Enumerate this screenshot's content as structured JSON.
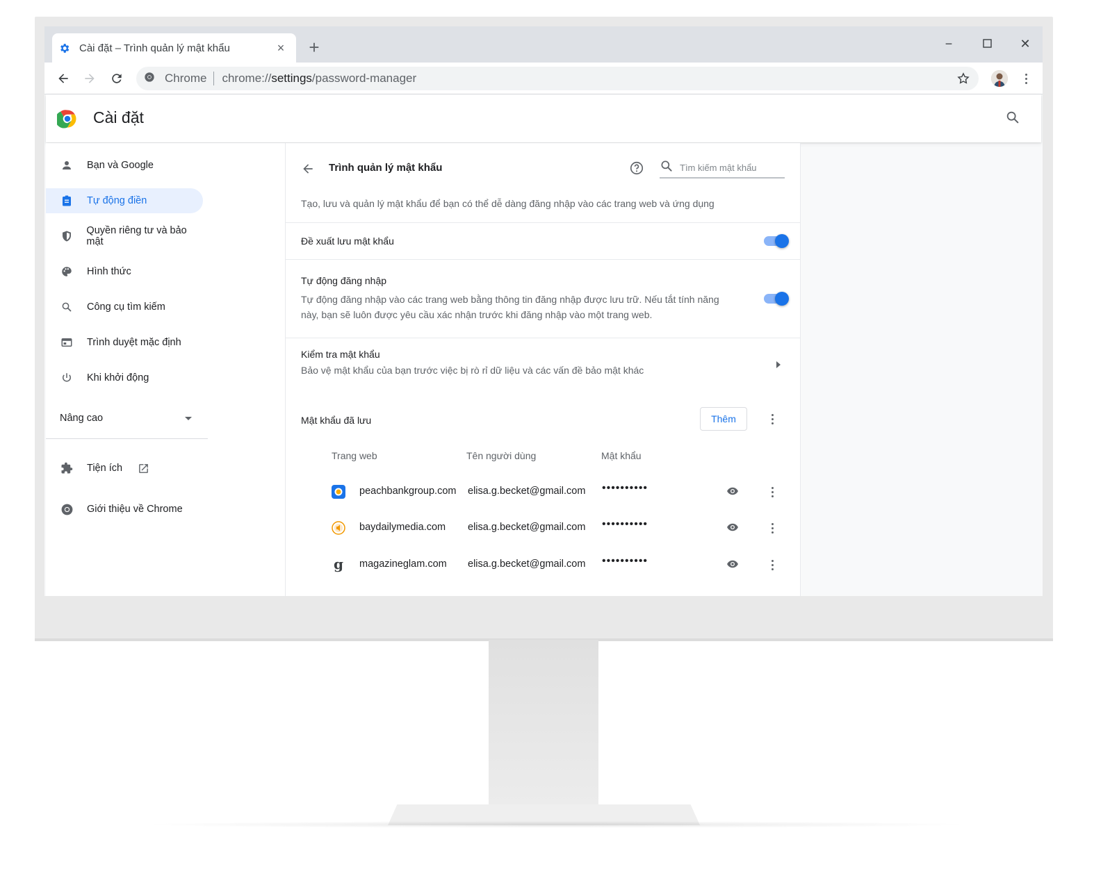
{
  "tab": {
    "title": "Cài đặt – Trình quản lý mật khẩu",
    "close": "×",
    "new_tab": "+"
  },
  "window_controls": {
    "minimize": "−",
    "maximize": "☐",
    "close": "✕"
  },
  "omnibox": {
    "site_label": "Chrome",
    "url_scheme": "chrome://",
    "url_host": "settings",
    "url_path": "/password-manager"
  },
  "header": {
    "title": "Cài đặt"
  },
  "sidebar": {
    "items": [
      {
        "label": "Bạn và Google",
        "icon": "person-icon"
      },
      {
        "label": "Tự động điền",
        "icon": "assignment-icon",
        "active": true
      },
      {
        "label": "Quyền riêng tư và bảo mật",
        "icon": "shield-icon"
      },
      {
        "label": "Hình thức",
        "icon": "palette-icon"
      },
      {
        "label": "Công cụ tìm kiếm",
        "icon": "search-icon"
      },
      {
        "label": "Trình duyệt mặc định",
        "icon": "browser-icon"
      },
      {
        "label": "Khi khởi động",
        "icon": "power-icon"
      }
    ],
    "advanced_label": "Nâng cao",
    "extensions_label": "Tiện ích",
    "about_label": "Giới thiệu về Chrome"
  },
  "password_manager": {
    "title": "Trình quản lý mật khẩu",
    "search_placeholder": "Tìm kiếm mật khẩu",
    "description": "Tạo, lưu và quản lý mật khẩu để bạn có thể dễ dàng đăng nhập vào các trang web và ứng dụng",
    "offer_save": {
      "label": "Đề xuất lưu mật khẩu",
      "enabled": true
    },
    "auto_signin": {
      "label": "Tự động đăng nhập",
      "description_line1": "Tự động đăng nhập vào các trang web bằng thông tin đăng nhập được lưu trữ. Nếu tắt tính năng",
      "description_line2": "này, bạn sẽ luôn được yêu cầu xác nhận trước khi đăng nhập vào một trang web.",
      "enabled": true
    },
    "check": {
      "label": "Kiểm tra mật khẩu",
      "description": "Bảo vệ mật khẩu của bạn trước việc bị rò rỉ dữ liệu và các vấn đề bảo mật khác"
    },
    "saved": {
      "label": "Mật khẩu đã lưu",
      "add_button": "Thêm",
      "columns": {
        "site": "Trang web",
        "username": "Tên người dùng",
        "password": "Mật khẩu"
      },
      "rows": [
        {
          "site": "peachbankgroup.com",
          "username": "elisa.g.becket@gmail.com",
          "password": "••••••••••",
          "favicon": "bank-icon"
        },
        {
          "site": "baydailymedia.com",
          "username": "elisa.g.becket@gmail.com",
          "password": "••••••••••",
          "favicon": "media-icon"
        },
        {
          "site": "magazineglam.com",
          "username": "elisa.g.becket@gmail.com",
          "password": "••••••••••",
          "favicon": "g-icon",
          "favicon_glyph": "g"
        }
      ]
    }
  },
  "colors": {
    "accent": "#1a73e8",
    "active_bg": "#e8f0fe"
  }
}
